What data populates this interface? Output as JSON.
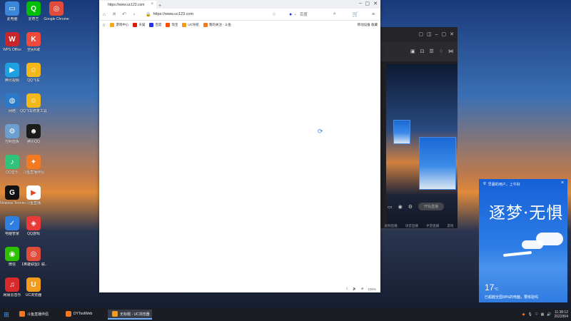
{
  "desktop": {
    "col1": [
      {
        "label": "此电脑",
        "icon": "computer-icon",
        "color": "#3a86d8",
        "glyph": "▭"
      },
      {
        "label": "WPS Office",
        "icon": "wps-icon",
        "color": "#c8262b",
        "glyph": "W"
      },
      {
        "label": "腾讯视频",
        "icon": "tencent-video-icon",
        "color": "#1fa0e0",
        "glyph": "▶"
      },
      {
        "label": "网络",
        "icon": "network-icon",
        "color": "#2b7ac9",
        "glyph": "◍"
      },
      {
        "label": "控制面板",
        "icon": "control-panel-icon",
        "color": "#6a9fd0",
        "glyph": "⚙"
      },
      {
        "label": "QQ音乐",
        "icon": "qq-music-icon",
        "color": "#31c27c",
        "glyph": "♪"
      },
      {
        "label": "Windows Terminal",
        "icon": "terminal-icon",
        "color": "#111111",
        "glyph": "G"
      },
      {
        "label": "电脑管家",
        "icon": "pc-manager-icon",
        "color": "#2e7fe0",
        "glyph": "✓"
      },
      {
        "label": "微信",
        "icon": "wechat-icon",
        "color": "#2dc100",
        "glyph": "◉"
      },
      {
        "label": "网易云音乐",
        "icon": "netease-music-icon",
        "color": "#d82a2a",
        "glyph": "♫"
      }
    ],
    "col2": [
      {
        "label": "爱奇艺",
        "icon": "iqiyi-icon",
        "color": "#00be06",
        "glyph": "Q"
      },
      {
        "label": "全民K歌",
        "icon": "kge-icon",
        "color": "#f04a3c",
        "glyph": "K"
      },
      {
        "label": "QQ飞车",
        "icon": "qq-speed-icon",
        "color": "#f2b81a",
        "glyph": "☺"
      },
      {
        "label": "QQ飞车修复工具",
        "icon": "qq-speed-repair-icon",
        "color": "#f2b81a",
        "glyph": "☺"
      },
      {
        "label": "腾讯QQ",
        "icon": "qq-icon",
        "color": "#1b1b1b",
        "glyph": "☻"
      },
      {
        "label": "斗鱼直播伴侣",
        "icon": "douyu-icon",
        "color": "#f37a20",
        "glyph": "✦"
      },
      {
        "label": "斗鱼直播",
        "icon": "douyu-live-icon",
        "color": "#ffffff",
        "glyph": "▶"
      },
      {
        "label": "QQ游戏",
        "icon": "qq-game-icon",
        "color": "#e93a3a",
        "glyph": "◈"
      },
      {
        "label": "【英雄联盟】联...",
        "icon": "chrome-shortcut-icon",
        "color": "#e04b3a",
        "glyph": "◎"
      },
      {
        "label": "UC浏览器",
        "icon": "uc-browser-icon",
        "color": "#f29c1f",
        "glyph": "U"
      }
    ],
    "col3": [
      {
        "label": "Google Chrome",
        "icon": "chrome-icon",
        "color": "#e04b3a",
        "glyph": "◎"
      }
    ]
  },
  "browser": {
    "tab_title": "https://www.uc123.com",
    "new_tab": "+",
    "url": "https://www.uc123.com",
    "search_engine": "百度",
    "bookmarks": [
      {
        "label": "游戏中心",
        "color": "#f5a623"
      },
      {
        "label": "天猫",
        "color": "#d81e06"
      },
      {
        "label": "百度",
        "color": "#2932e1"
      },
      {
        "label": "淘宝",
        "color": "#ff5000"
      },
      {
        "label": "UC导航",
        "color": "#f29c1f"
      },
      {
        "label": "我的关注 - 斗鱼",
        "color": "#f37a20"
      }
    ],
    "bookmarks_right": "移动设备 收藏",
    "zoom": "100%"
  },
  "popup": {
    "header": "早晨的用户，上午好",
    "calligraphy": "逐梦·无惧",
    "temp": "17",
    "temp_unit": "°C",
    "message": "已超越全国99%的电脑，要体验吗"
  },
  "bgapp": {
    "start_live": "开始直播",
    "bottom_labels": [
      "视频直播",
      "语音直播",
      "手游直播",
      "游戏"
    ]
  },
  "taskbar": {
    "tasks": [
      {
        "label": "斗鱼直播伴侣",
        "color": "#f37a20",
        "active": false
      },
      {
        "label": "DYToolWeb",
        "color": "#f37a20",
        "active": false
      },
      {
        "label": "无标题 - UC浏览器",
        "color": "#f29c1f",
        "active": true
      }
    ],
    "time": "11:38:12",
    "date": "2022/8/4"
  }
}
